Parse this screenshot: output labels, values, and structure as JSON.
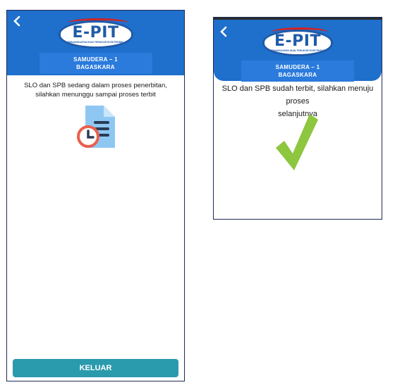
{
  "left_screen": {
    "back_icon": "chevron-left-icon",
    "logo": {
      "text": "E-PIT",
      "subtitle": "PENANGKAPAN IKAN TERUKUR ELEKTRONIK"
    },
    "vessel": {
      "line1": "SAMUDERA – 1",
      "line2": "BAGASKARA"
    },
    "message_line1": "SLO dan SPB sedang dalam proses penerbitan,",
    "message_line2": "silahkan menunggu sampai proses terbit",
    "status_icon": "document-clock-icon",
    "button_label": "KELUAR"
  },
  "right_screen": {
    "back_icon": "chevron-left-icon",
    "logo": {
      "text": "E-PIT",
      "subtitle": "PENANGKAPAN IKAN TERUKUR ELEKTRONIK"
    },
    "vessel": {
      "line1": "SAMUDERA – 1",
      "line2": "BAGASKARA"
    },
    "message_line1": "SLO dan SPB sudah terbit, silahkan menuju proses",
    "message_line2": "selanjutnya",
    "status_icon": "checkmark-icon"
  },
  "colors": {
    "header": "#1f6fcc",
    "button": "#2a9aad",
    "check": "#8dc63f",
    "doc": "#8ec8f2",
    "clock": "#e8604c"
  }
}
